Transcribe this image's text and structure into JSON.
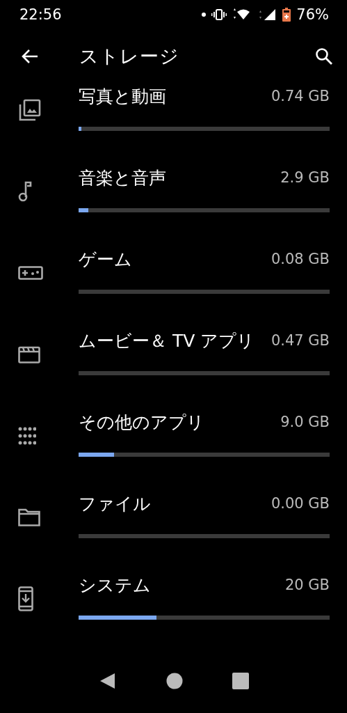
{
  "status_bar": {
    "time": "22:56",
    "battery": "76%"
  },
  "toolbar": {
    "title": "ストレージ"
  },
  "categories": [
    {
      "kind": "photos",
      "name": "写真と動画",
      "size": "0.74 GB",
      "level": 0.012
    },
    {
      "kind": "music",
      "name": "音楽と音声",
      "size": "2.9 GB",
      "level": 0.04
    },
    {
      "kind": "games",
      "name": "ゲーム",
      "size": "0.08 GB"
    },
    {
      "kind": "movies",
      "name": "ムービー＆ TV アプリ",
      "size": "0.47 GB"
    },
    {
      "kind": "apps",
      "name": "その他のアプリ",
      "size": "9.0 GB",
      "level": 0.14
    },
    {
      "kind": "files",
      "name": "ファイル",
      "size": "0.00 GB"
    },
    {
      "kind": "system",
      "name": "システム",
      "size": "20 GB",
      "level": 0.31
    }
  ]
}
